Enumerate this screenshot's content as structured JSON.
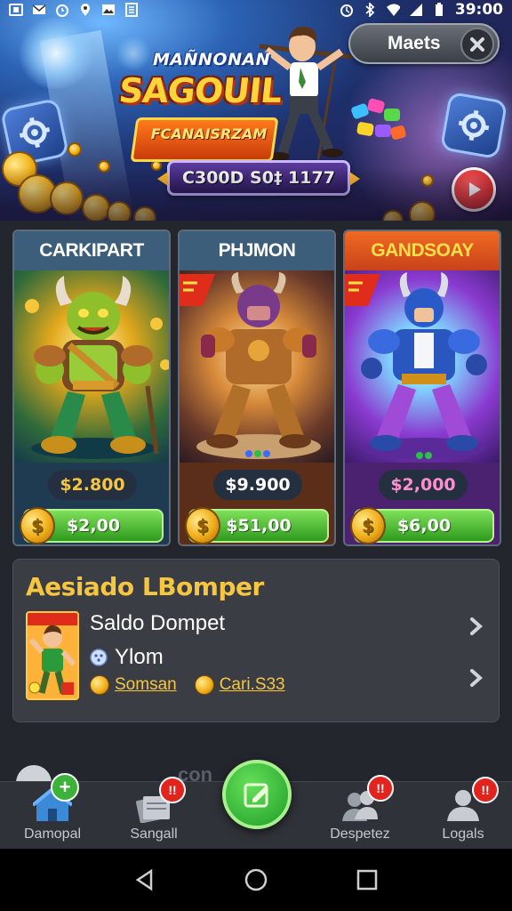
{
  "status_bar": {
    "time": "39:00",
    "left_icons": [
      "notification-box-icon",
      "mail-icon",
      "alarm-icon",
      "location-icon",
      "image-icon",
      "document-icon"
    ],
    "right_icons": [
      "alarm-clock-icon",
      "bluetooth-icon",
      "wifi-icon",
      "signal-icon",
      "battery-icon"
    ]
  },
  "hero": {
    "logo_top": "MAÑNONAN",
    "logo_main": "SAGOUIL",
    "logo_sub": "FCANAISRZAM",
    "score": "C300D S0‡ 1177",
    "maets_label": "Maets"
  },
  "cards": [
    {
      "title": "CARKIPART",
      "price": "$2.800",
      "buy": "$2,00",
      "theme": "green",
      "title_color": "#ffffff",
      "header_bg": "#3c5e7a"
    },
    {
      "title": "PHJMON",
      "price": "$9.900",
      "buy": "$51,00",
      "theme": "bronze",
      "title_color": "#ffffff",
      "header_bg": "#3c5e7a"
    },
    {
      "title": "GANDSOAY",
      "price": "$2,000",
      "buy": "$6,00",
      "theme": "purple",
      "title_color": "#ffe04a",
      "header_bg": "#e0561d"
    }
  ],
  "info_panel": {
    "title": "Aesiado LBomper",
    "line1": "Saldo Dompet",
    "line2": "Ylom",
    "links": [
      "Somsan",
      "Cari.S33"
    ]
  },
  "ghost_text": "con",
  "bottom_nav": {
    "items": [
      {
        "label": "Damopal",
        "icon": "home-icon"
      },
      {
        "label": "Sangall",
        "icon": "cards-icon"
      },
      {
        "label": "Despetez",
        "icon": "people-icon"
      },
      {
        "label": "Logals",
        "icon": "user-icon"
      }
    ],
    "center_icon": "edit-square-icon"
  },
  "colors": {
    "accent_green": "#3bb23a",
    "badge_red": "#e3231e",
    "gold": "#f6c640",
    "panel": "#3a3d44"
  }
}
